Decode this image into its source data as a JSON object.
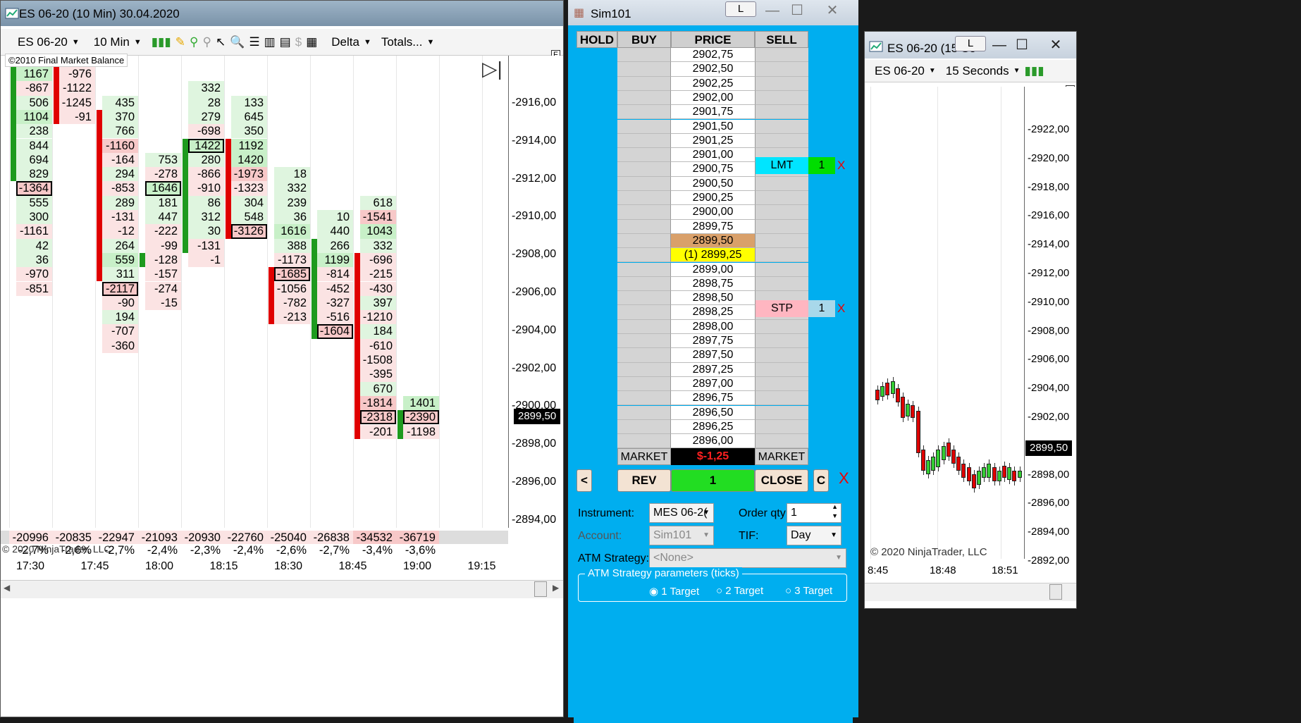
{
  "chart1": {
    "title": "ES 06-20 (10 Min)  30.04.2020",
    "instrument": "ES 06-20",
    "interval": "10 Min",
    "indicator": "Delta",
    "totals": "Totals...",
    "copyright_top": "©2010 Final Market Balance",
    "copyright_bottom": "© 2020 NinjaTrader, LLC",
    "f_label": "F",
    "price_tag": "2899,50",
    "price_axis": [
      "2916,00",
      "2914,00",
      "2912,00",
      "2910,00",
      "2908,00",
      "2906,00",
      "2904,00",
      "2902,00",
      "2900,00",
      "2898,00",
      "2896,00",
      "2894,00"
    ],
    "time_axis": [
      "17:30",
      "17:45",
      "18:00",
      "18:15",
      "18:30",
      "18:45",
      "19:00",
      "19:15"
    ],
    "totals_row": [
      "-20996",
      "-20835",
      "-22947",
      "-21093",
      "-20930",
      "-22760",
      "-25040",
      "-26838",
      "-34532",
      "-36719"
    ],
    "pct_row": [
      "-2,7%",
      "-2,6%",
      "-2,7%",
      "-2,4%",
      "-2,3%",
      "-2,4%",
      "-2,6%",
      "-2,7%",
      "-3,4%",
      "-3,6%"
    ],
    "columns": [
      {
        "cells": [
          [
            "1167",
            "pos2"
          ],
          [
            "-867",
            "neg"
          ],
          [
            "506",
            "pos"
          ],
          [
            "1104",
            "pos2"
          ],
          [
            "238",
            "pos"
          ],
          [
            "844",
            "pos"
          ],
          [
            "694",
            "pos"
          ],
          [
            "829",
            "pos"
          ],
          [
            "-1364",
            "neg2 boxed"
          ],
          [
            "555",
            "pos"
          ],
          [
            "300",
            "pos"
          ],
          [
            "-1161",
            "neg"
          ],
          [
            "42",
            "pos"
          ],
          [
            "36",
            "pos"
          ],
          [
            "-970",
            "neg"
          ],
          [
            "-851",
            "neg"
          ]
        ],
        "start": 0
      },
      {
        "cells": [
          [
            "-976",
            "neg"
          ],
          [
            "-1122",
            "neg"
          ],
          [
            "-1245",
            "neg"
          ],
          [
            "-91",
            "neg"
          ]
        ],
        "start": 0
      },
      {
        "cells": [
          [
            "435",
            "pos"
          ],
          [
            "370",
            "pos"
          ],
          [
            "766",
            "pos"
          ],
          [
            "-1160",
            "neg2"
          ],
          [
            "-164",
            "neg"
          ],
          [
            "294",
            "pos"
          ],
          [
            "-853",
            "neg"
          ],
          [
            "289",
            "pos"
          ],
          [
            "-131",
            "neg"
          ],
          [
            "-12",
            "neg"
          ],
          [
            "264",
            "pos"
          ],
          [
            "559",
            "pos2"
          ],
          [
            "311",
            "pos"
          ],
          [
            "-2117",
            "neg2 boxed"
          ],
          [
            "-90",
            "neg"
          ],
          [
            "194",
            "pos"
          ],
          [
            "-707",
            "neg"
          ],
          [
            "-360",
            "neg"
          ]
        ],
        "start": 2
      },
      {
        "cells": [
          [
            "753",
            "pos"
          ],
          [
            "-278",
            "neg"
          ],
          [
            "1646",
            "pos2 boxed"
          ],
          [
            "181",
            "pos"
          ],
          [
            "447",
            "pos"
          ],
          [
            "-222",
            "neg"
          ],
          [
            "-99",
            "neg"
          ],
          [
            "-128",
            "neg"
          ],
          [
            "-157",
            "neg"
          ],
          [
            "-274",
            "neg"
          ],
          [
            "-15",
            "neg"
          ]
        ],
        "start": 6
      },
      {
        "cells": [
          [
            "332",
            "pos"
          ],
          [
            "28",
            "pos"
          ],
          [
            "279",
            "pos"
          ],
          [
            "-698",
            "neg"
          ],
          [
            "1422",
            "pos2 boxed"
          ],
          [
            "280",
            "pos"
          ],
          [
            "-866",
            "neg"
          ],
          [
            "-910",
            "neg"
          ],
          [
            "86",
            "pos"
          ],
          [
            "312",
            "pos"
          ],
          [
            "30",
            "pos"
          ],
          [
            "-131",
            "neg"
          ],
          [
            "-1",
            "neg"
          ]
        ],
        "start": 1
      },
      {
        "cells": [
          [
            "133",
            "pos"
          ],
          [
            "645",
            "pos"
          ],
          [
            "350",
            "pos"
          ],
          [
            "1192",
            "pos2"
          ],
          [
            "1420",
            "pos2"
          ],
          [
            "-1973",
            "neg2"
          ],
          [
            "-1323",
            "neg"
          ],
          [
            "304",
            "pos"
          ],
          [
            "548",
            "pos"
          ],
          [
            "-3126",
            "neg2 boxed"
          ]
        ],
        "start": 2
      },
      {
        "cells": [
          [
            "18",
            "pos"
          ],
          [
            "332",
            "pos"
          ],
          [
            "239",
            "pos"
          ],
          [
            "36",
            "pos"
          ],
          [
            "1616",
            "pos2"
          ],
          [
            "388",
            "pos"
          ],
          [
            "-1173",
            "neg"
          ],
          [
            "-1685",
            "neg2 boxed"
          ],
          [
            "-1056",
            "neg"
          ],
          [
            "-782",
            "neg"
          ],
          [
            "-213",
            "neg"
          ]
        ],
        "start": 7
      },
      {
        "cells": [
          [
            "10",
            "pos"
          ],
          [
            "440",
            "pos"
          ],
          [
            "266",
            "pos"
          ],
          [
            "1199",
            "pos2"
          ],
          [
            "-814",
            "neg"
          ],
          [
            "-452",
            "neg"
          ],
          [
            "-327",
            "neg"
          ],
          [
            "-516",
            "neg"
          ],
          [
            "-1604",
            "neg2 boxed"
          ]
        ],
        "start": 10
      },
      {
        "cells": [
          [
            "618",
            "pos"
          ],
          [
            "-1541",
            "neg2"
          ],
          [
            "1043",
            "pos2"
          ],
          [
            "332",
            "pos"
          ],
          [
            "-696",
            "neg"
          ],
          [
            "-215",
            "neg"
          ],
          [
            "-430",
            "neg"
          ],
          [
            "397",
            "pos"
          ],
          [
            "-1210",
            "neg"
          ],
          [
            "184",
            "pos"
          ],
          [
            "-610",
            "neg"
          ],
          [
            "-1508",
            "neg"
          ],
          [
            "-395",
            "neg"
          ],
          [
            "670",
            "pos"
          ],
          [
            "-1814",
            "neg2"
          ],
          [
            "-2318",
            "neg2 boxed"
          ],
          [
            "-201",
            "neg"
          ]
        ],
        "start": 9
      },
      {
        "cells": [
          [
            "1401",
            "pos2"
          ],
          [
            "-2390",
            "neg2 boxed"
          ],
          [
            "-1198",
            "neg"
          ]
        ],
        "start": 23
      }
    ]
  },
  "dom": {
    "title": "Sim101",
    "headers": {
      "hold": "HOLD",
      "buy": "BUY",
      "price": "PRICE",
      "sell": "SELL"
    },
    "prices": [
      "2902,75",
      "2902,50",
      "2902,25",
      "2902,00",
      "2901,75",
      "2901,50",
      "2901,25",
      "2901,00",
      "2900,75",
      "2900,50",
      "2900,25",
      "2900,00",
      "2899,75",
      "2899,50",
      "(1) 2899,25",
      "2899,00",
      "2898,75",
      "2898,50",
      "2898,25",
      "2898,00",
      "2897,75",
      "2897,50",
      "2897,25",
      "2897,00",
      "2896,75",
      "2896,50",
      "2896,25",
      "2896,00"
    ],
    "lmt_label": "LMT",
    "lmt_qty": "1",
    "stp_label": "STP",
    "stp_qty": "1",
    "cancel_x": "X",
    "market_buy": "MARKET",
    "pnl": "$-1,25",
    "market_sell": "MARKET",
    "btn_left": "<",
    "btn_rev": "REV",
    "position_qty": "1",
    "btn_close": "CLOSE",
    "btn_c": "C",
    "btn_x": "X",
    "instrument_label": "Instrument:",
    "instrument_value": "MES 06-2(",
    "orderqty_label": "Order qty:",
    "orderqty_value": "1",
    "account_label": "Account:",
    "account_value": "Sim101",
    "tif_label": "TIF:",
    "tif_value": "Day",
    "atm_label": "ATM Strategy:",
    "atm_value": "<None>",
    "atm_params": "ATM Strategy parameters (ticks)",
    "t1": "1 Target",
    "t2": "2 Target",
    "t3": "3 Target",
    "l_btn": "L"
  },
  "chart2": {
    "title": "ES 06-20 (15 Se",
    "instrument": "ES 06-20",
    "interval": "15 Seconds",
    "f_label": "F",
    "l_btn": "L",
    "price_tag": "2899,50",
    "price_axis": [
      "2922,00",
      "2920,00",
      "2918,00",
      "2916,00",
      "2914,00",
      "2912,00",
      "2910,00",
      "2908,00",
      "2906,00",
      "2904,00",
      "2902,00",
      "2900,00",
      "2898,00",
      "2896,00",
      "2894,00",
      "2892,00"
    ],
    "time_axis": [
      "8:45",
      "18:48",
      "18:51"
    ],
    "copyright": "© 2020 NinjaTrader, LLC"
  },
  "colors": {
    "up": "#1e9a1e",
    "down": "#e00000",
    "dom_bg": "#00aeef",
    "lmt": "#00e5ff",
    "stp": "#ffb6c1",
    "current": "#ffff00",
    "last": "#d9a06a"
  }
}
